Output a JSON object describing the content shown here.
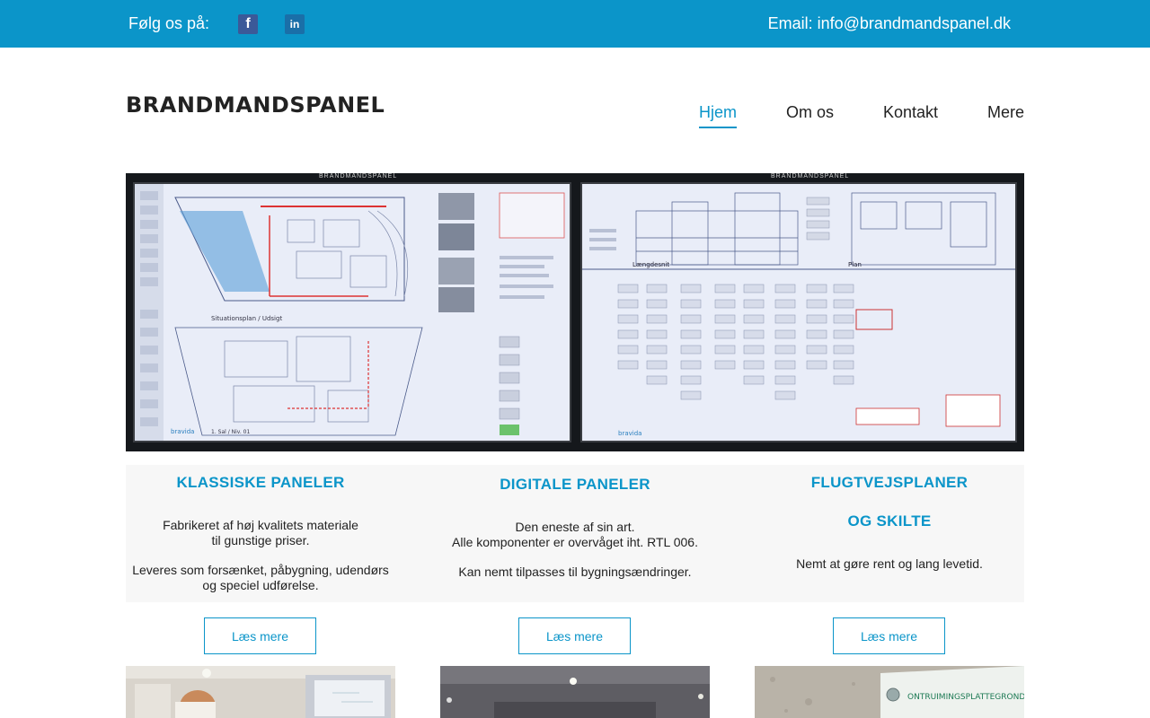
{
  "topbar": {
    "follow_label": "Følg os på:",
    "social": [
      {
        "name": "facebook",
        "glyph": "f"
      },
      {
        "name": "linkedin",
        "glyph": "in"
      }
    ],
    "email": "Email: info@brandmandspanel.dk",
    "color": "#0b95c9"
  },
  "header": {
    "logo": "BRANDMANDSPANEL",
    "nav": [
      {
        "label": "Hjem",
        "active": true
      },
      {
        "label": "Om os",
        "active": false
      },
      {
        "label": "Kontakt",
        "active": false
      },
      {
        "label": "Mere",
        "active": false
      }
    ]
  },
  "hero": {
    "left_screen_title": "BRANDMANDSPANEL",
    "right_screen_title": "BRANDMANDSPANEL",
    "left_caption": "1. Sal / Niv. 01",
    "left_section_label": "Situationsplan / Udsigt",
    "right_section_label": "Længdesnit",
    "right_plan_label": "Plan"
  },
  "features": [
    {
      "title_lines": [
        "KLASSISKE PANELER"
      ],
      "paragraphs": [
        [
          "Fabrikeret af høj kvalitets materiale",
          "til gunstige priser."
        ],
        [
          "Leveres som forsænket, påbygning, udendørs",
          "og speciel udførelse."
        ]
      ],
      "button": "Læs mere"
    },
    {
      "title_lines": [
        "DIGITALE PANELER"
      ],
      "paragraphs": [
        [
          "Den eneste af sin art.",
          "Alle komponenter er overvåget iht. RTL 006."
        ],
        [
          "Kan nemt tilpasses til bygningsændringer."
        ]
      ],
      "button": "Læs mere"
    },
    {
      "title_lines": [
        "FLUGTVEJSPLANER",
        "OG SKILTE"
      ],
      "paragraphs": [
        [
          "Nemt at gøre rent og lang levetid."
        ]
      ],
      "button": "Læs mere"
    }
  ],
  "photos": {
    "third_sign_text": "ONTRUIMINGSPLATTEGROND"
  }
}
